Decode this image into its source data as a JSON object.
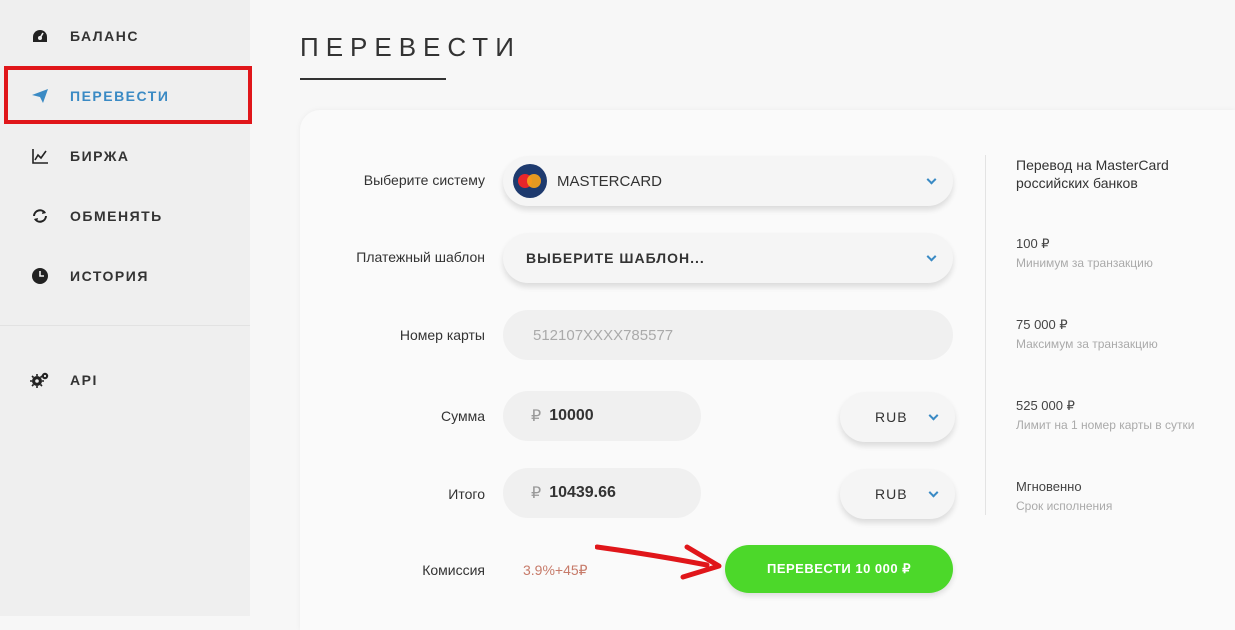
{
  "sidebar": {
    "items": [
      {
        "label": "БАЛАНС",
        "icon": "dashboard-icon"
      },
      {
        "label": "ПЕРЕВЕСТИ",
        "icon": "send-icon",
        "active": true
      },
      {
        "label": "БИРЖА",
        "icon": "chart-icon"
      },
      {
        "label": "ОБМЕНЯТЬ",
        "icon": "exchange-icon"
      },
      {
        "label": "ИСТОРИЯ",
        "icon": "clock-icon"
      },
      {
        "label": "API",
        "icon": "gears-icon"
      }
    ]
  },
  "page": {
    "title": "ПЕРЕВЕСТИ"
  },
  "form": {
    "system_label": "Выберите систему",
    "system_value": "MASTERCARD",
    "template_label": "Платежный шаблон",
    "template_value": "ВЫБЕРИТЕ ШАБЛОН...",
    "card_label": "Номер карты",
    "card_placeholder": "512107XXXX785577",
    "amount_label": "Сумма",
    "amount_symbol": "₽",
    "amount_value": "10000",
    "amount_currency": "RUB",
    "total_label": "Итого",
    "total_symbol": "₽",
    "total_value": "10439.66",
    "total_currency": "RUB",
    "commission_label": "Комиссия",
    "commission_value": "3.9%+45₽",
    "submit_label": "ПЕРЕВЕСТИ 10 000 ₽"
  },
  "info": {
    "title": "Перевод на MasterCard российских банков",
    "rows": [
      {
        "value": "100 ₽",
        "desc": "Минимум за транзакцию"
      },
      {
        "value": "75 000 ₽",
        "desc": "Максимум за транзакцию"
      },
      {
        "value": "525 000 ₽",
        "desc": "Лимит на 1 номер карты в сутки"
      },
      {
        "value": "Мгновенно",
        "desc": "Срок исполнения"
      }
    ]
  },
  "colors": {
    "accent": "#3a8ac4",
    "submit": "#4cd82a",
    "highlight": "#e0161a",
    "commission": "#c77b6a"
  }
}
